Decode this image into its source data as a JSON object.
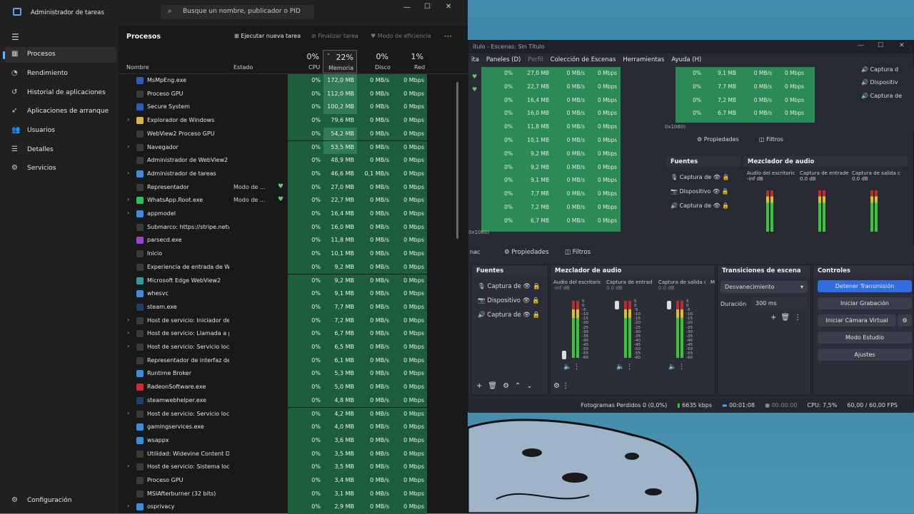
{
  "task_manager": {
    "title": "Administrador de tareas",
    "search_placeholder": "Busque un nombre, publicador o PID",
    "nav": [
      "Procesos",
      "Rendimiento",
      "Historial de aplicaciones",
      "Aplicaciones de arranque",
      "Usuarios",
      "Detalles",
      "Servicios"
    ],
    "settings": "Configuración",
    "section": "Procesos",
    "toolbar": {
      "new_task": "Ejecutar nueva tarea",
      "end_task": "Finalizar tarea",
      "efficiency": "Modo de eficiencia"
    },
    "columns": {
      "name": "Nombre",
      "status": "Estado",
      "cpu": "CPU",
      "memory": "Memoria",
      "disk": "Disco",
      "network": "Red"
    },
    "totals": {
      "cpu": "0%",
      "memory": "22%",
      "disk": "0%",
      "network": "1%"
    },
    "rows": [
      {
        "name": "MsMpEng.exe",
        "state": "",
        "cpu": "0%",
        "mem": "172,0 MB",
        "disk": "0 MB/s",
        "net": "0 Mbps",
        "exp": false,
        "ic": "#2b5fbf"
      },
      {
        "name": "Proceso GPU",
        "state": "",
        "cpu": "0%",
        "mem": "112,0 MB",
        "disk": "0 MB/s",
        "net": "0 Mbps",
        "exp": false,
        "ic": "#3a3a3a"
      },
      {
        "name": "Secure System",
        "state": "",
        "cpu": "0%",
        "mem": "100,2 MB",
        "disk": "0 MB/s",
        "net": "0 Mbps",
        "exp": false,
        "ic": "#2b5fbf"
      },
      {
        "name": "Explorador de Windows",
        "state": "",
        "cpu": "0%",
        "mem": "79,6 MB",
        "disk": "0 MB/s",
        "net": "0 Mbps",
        "exp": true,
        "ic": "#e0b33a"
      },
      {
        "name": "WebView2 Proceso GPU",
        "state": "",
        "cpu": "0%",
        "mem": "54,2 MB",
        "disk": "0 MB/s",
        "net": "0 Mbps",
        "exp": false,
        "ic": "#3a3a3a"
      },
      {
        "name": "Navegador",
        "state": "",
        "cpu": "0%",
        "mem": "53,5 MB",
        "disk": "0 MB/s",
        "net": "0 Mbps",
        "exp": true,
        "ic": "#3a3a3a"
      },
      {
        "name": "Administrador de WebView2",
        "state": "",
        "cpu": "0%",
        "mem": "48,9 MB",
        "disk": "0 MB/s",
        "net": "0 Mbps",
        "exp": false,
        "ic": "#3a3a3a"
      },
      {
        "name": "Administrador de tareas",
        "state": "",
        "cpu": "0%",
        "mem": "46,6 MB",
        "disk": "0,1 MB/s",
        "net": "0 Mbps",
        "exp": true,
        "ic": "#3b8de0"
      },
      {
        "name": "Representador",
        "state": "Modo de ...",
        "cpu": "0%",
        "mem": "27,0 MB",
        "disk": "0 MB/s",
        "net": "0 Mbps",
        "exp": false,
        "ic": "#3a3a3a",
        "leaf": true
      },
      {
        "name": "WhatsApp.Root.exe",
        "state": "Modo de ...",
        "cpu": "0%",
        "mem": "22,7 MB",
        "disk": "0 MB/s",
        "net": "0 Mbps",
        "exp": true,
        "ic": "#2fbf5b",
        "leaf": true
      },
      {
        "name": "appmodel",
        "state": "",
        "cpu": "0%",
        "mem": "16,4 MB",
        "disk": "0 MB/s",
        "net": "0 Mbps",
        "exp": true,
        "ic": "#3b8de0"
      },
      {
        "name": "Submarco: https://stripe.netw...",
        "state": "",
        "cpu": "0%",
        "mem": "16,0 MB",
        "disk": "0 MB/s",
        "net": "0 Mbps",
        "exp": false,
        "ic": "#3a3a3a"
      },
      {
        "name": "parsecd.exe",
        "state": "",
        "cpu": "0%",
        "mem": "11,8 MB",
        "disk": "0 MB/s",
        "net": "0 Mbps",
        "exp": false,
        "ic": "#a33fd6"
      },
      {
        "name": "Inicio",
        "state": "",
        "cpu": "0%",
        "mem": "10,1 MB",
        "disk": "0 MB/s",
        "net": "0 Mbps",
        "exp": false,
        "ic": "#3a3a3a"
      },
      {
        "name": "Experiencia de entrada de Win...",
        "state": "",
        "cpu": "0%",
        "mem": "9,2 MB",
        "disk": "0 MB/s",
        "net": "0 Mbps",
        "exp": false,
        "ic": "#3a3a3a"
      },
      {
        "name": "Microsoft Edge WebView2",
        "state": "",
        "cpu": "0%",
        "mem": "9,2 MB",
        "disk": "0 MB/s",
        "net": "0 Mbps",
        "exp": false,
        "ic": "#2aa0a0"
      },
      {
        "name": "whesvc",
        "state": "",
        "cpu": "0%",
        "mem": "9,1 MB",
        "disk": "0 MB/s",
        "net": "0 Mbps",
        "exp": false,
        "ic": "#3b8de0"
      },
      {
        "name": "steam.exe",
        "state": "",
        "cpu": "0%",
        "mem": "7,7 MB",
        "disk": "0 MB/s",
        "net": "0 Mbps",
        "exp": false,
        "ic": "#1b3f6e"
      },
      {
        "name": "Host de servicio: Iniciador de ...",
        "state": "",
        "cpu": "0%",
        "mem": "7,2 MB",
        "disk": "0 MB/s",
        "net": "0 Mbps",
        "exp": true,
        "ic": "#3a3a3a"
      },
      {
        "name": "Host de servicio: Llamada a pr...",
        "state": "",
        "cpu": "0%",
        "mem": "6,7 MB",
        "disk": "0 MB/s",
        "net": "0 Mbps",
        "exp": true,
        "ic": "#3a3a3a"
      },
      {
        "name": "Host de servicio: Servicio local...",
        "state": "",
        "cpu": "0%",
        "mem": "6,5 MB",
        "disk": "0 MB/s",
        "net": "0 Mbps",
        "exp": true,
        "ic": "#3a3a3a"
      },
      {
        "name": "Representador de interfaz de u...",
        "state": "",
        "cpu": "0%",
        "mem": "6,1 MB",
        "disk": "0 MB/s",
        "net": "0 Mbps",
        "exp": false,
        "ic": "#3a3a3a"
      },
      {
        "name": "Runtime Broker",
        "state": "",
        "cpu": "0%",
        "mem": "5,3 MB",
        "disk": "0 MB/s",
        "net": "0 Mbps",
        "exp": false,
        "ic": "#3b8de0"
      },
      {
        "name": "RadeonSoftware.exe",
        "state": "",
        "cpu": "0%",
        "mem": "5,0 MB",
        "disk": "0 MB/s",
        "net": "0 Mbps",
        "exp": false,
        "ic": "#d42a2a"
      },
      {
        "name": "steamwebhelper.exe",
        "state": "",
        "cpu": "0%",
        "mem": "4,8 MB",
        "disk": "0 MB/s",
        "net": "0 Mbps",
        "exp": false,
        "ic": "#1b3f6e"
      },
      {
        "name": "Host de servicio: Servicio local",
        "state": "",
        "cpu": "0%",
        "mem": "4,2 MB",
        "disk": "0 MB/s",
        "net": "0 Mbps",
        "exp": true,
        "ic": "#3a3a3a"
      },
      {
        "name": "gamingservices.exe",
        "state": "",
        "cpu": "0%",
        "mem": "4,0 MB",
        "disk": "0 MB/s",
        "net": "0 Mbps",
        "exp": false,
        "ic": "#3b8de0"
      },
      {
        "name": "wsappx",
        "state": "",
        "cpu": "0%",
        "mem": "3,6 MB",
        "disk": "0 MB/s",
        "net": "0 Mbps",
        "exp": false,
        "ic": "#3b8de0"
      },
      {
        "name": "Utilidad: Widevine Content De...",
        "state": "",
        "cpu": "0%",
        "mem": "3,5 MB",
        "disk": "0 MB/s",
        "net": "0 Mbps",
        "exp": false,
        "ic": "#3a3a3a"
      },
      {
        "name": "Host de servicio: Sistema local...",
        "state": "",
        "cpu": "0%",
        "mem": "3,5 MB",
        "disk": "0 MB/s",
        "net": "0 Mbps",
        "exp": true,
        "ic": "#3a3a3a"
      },
      {
        "name": "Proceso GPU",
        "state": "",
        "cpu": "0%",
        "mem": "3,4 MB",
        "disk": "0 MB/s",
        "net": "0 Mbps",
        "exp": false,
        "ic": "#3a3a3a"
      },
      {
        "name": "MSIAfterburner (32 bits)",
        "state": "",
        "cpu": "0%",
        "mem": "3,1 MB",
        "disk": "0 MB/s",
        "net": "0 Mbps",
        "exp": false,
        "ic": "#3a3a3a"
      },
      {
        "name": "osprivacy",
        "state": "",
        "cpu": "0%",
        "mem": "2,9 MB",
        "disk": "0 MB/s",
        "net": "0 Mbps",
        "exp": true,
        "ic": "#3b8de0"
      }
    ]
  },
  "obs": {
    "title": "ítulo - Escenas: Sin Título",
    "menu": [
      "ita",
      "Paneles (D)",
      "Perfil",
      "Colección de Escenas",
      "Herramientas",
      "Ayuda (H)"
    ],
    "grid_left": [
      [
        "0%",
        "27,0 MB",
        "0 MB/s",
        "0 Mbps"
      ],
      [
        "0%",
        "22,7 MB",
        "0 MB/s",
        "0 Mbps"
      ],
      [
        "0%",
        "16,4 MB",
        "0 MB/s",
        "0 Mbps"
      ],
      [
        "0%",
        "16,0 MB",
        "0 MB/s",
        "0 Mbps"
      ],
      [
        "0%",
        "11,8 MB",
        "0 MB/s",
        "0 Mbps"
      ],
      [
        "0%",
        "10,1 MB",
        "0 MB/s",
        "0 Mbps"
      ],
      [
        "0%",
        "9,2 MB",
        "0 MB/s",
        "0 Mbps"
      ],
      [
        "0%",
        "9,2 MB",
        "0 MB/s",
        "0 Mbps"
      ],
      [
        "0%",
        "9,1 MB",
        "0 MB/s",
        "0 Mbps"
      ],
      [
        "0%",
        "7,7 MB",
        "0 MB/s",
        "0 Mbps"
      ],
      [
        "0%",
        "7,2 MB",
        "0 MB/s",
        "0 Mbps"
      ],
      [
        "0%",
        "6,7 MB",
        "0 MB/s",
        "0 Mbps"
      ]
    ],
    "grid_right": [
      [
        "0%",
        "9,1 MB",
        "0 MB/s",
        "0 Mbps"
      ],
      [
        "0%",
        "7,7 MB",
        "0 MB/s",
        "0 Mbps"
      ],
      [
        "0%",
        "7,2 MB",
        "0 MB/s",
        "0 Mbps"
      ],
      [
        "0%",
        "6,7 MB",
        "0 MB/s",
        "0 Mbps"
      ]
    ],
    "res_small": "0x1080)",
    "res_left": "0x1080)",
    "inner": {
      "properties": "Propiedades",
      "filters": "Filtros",
      "sources_title": "Fuentes",
      "mixer_title": "Mezclador de audio",
      "sources": [
        "Captura de",
        "Dispositivo",
        "Captura de"
      ],
      "mixer": [
        {
          "name": "Audio del escritoric",
          "db": "-inf dB"
        },
        {
          "name": "Captura de entrade",
          "db": "0.0 dB"
        },
        {
          "name": "Captura de salida c",
          "db": "0.0 dB"
        }
      ]
    },
    "right_partial": [
      "Captura d",
      "Dispositiv",
      "Captura de"
    ],
    "lower": {
      "properties": "Propiedades",
      "filters": "Filtros",
      "left_cut": "nac",
      "sources_title": "Fuentes",
      "sources": [
        "Captura de",
        "Dispositivo",
        "Captura de"
      ],
      "mixer_title": "Mezclador de audio",
      "mixer": [
        {
          "name": "Audio del escritoric",
          "db": "-inf dB"
        },
        {
          "name": "Captura de entrad",
          "db": "0.0 dB"
        },
        {
          "name": "Captura de salida c",
          "db": "0.0 dB"
        },
        {
          "name": "M",
          "db": ""
        }
      ],
      "scale": [
        "5",
        "0",
        "-5",
        "-10",
        "-15",
        "-20",
        "-25",
        "-30",
        "-35",
        "-40",
        "-45",
        "-50",
        "-55",
        "-60"
      ],
      "transitions_title": "Transiciones de escena",
      "transition": "Desvanecimiento",
      "duration_label": "Duración",
      "duration": "300 ms",
      "controls_title": "Controles",
      "controls": [
        "Detener Transmisión",
        "Iniciar Grabación",
        "Iniciar Cámara Virtual",
        "Modo Estudio",
        "Ajustes"
      ]
    },
    "status": {
      "dropped": "Fotogramas Perdidos 0 (0,0%)",
      "kbps": "6635 kbps",
      "stream_time": "00:01:08",
      "rec_time": "00:00:00",
      "cpu": "CPU: 7,5%",
      "fps": "60,00 / 60,00 FPS"
    }
  },
  "colors": {
    "accent": "#4cc2ff",
    "heat_green": "#1d5e3c",
    "heat_strong": "#2b6f4f",
    "obs_blue": "#2f6de0"
  }
}
